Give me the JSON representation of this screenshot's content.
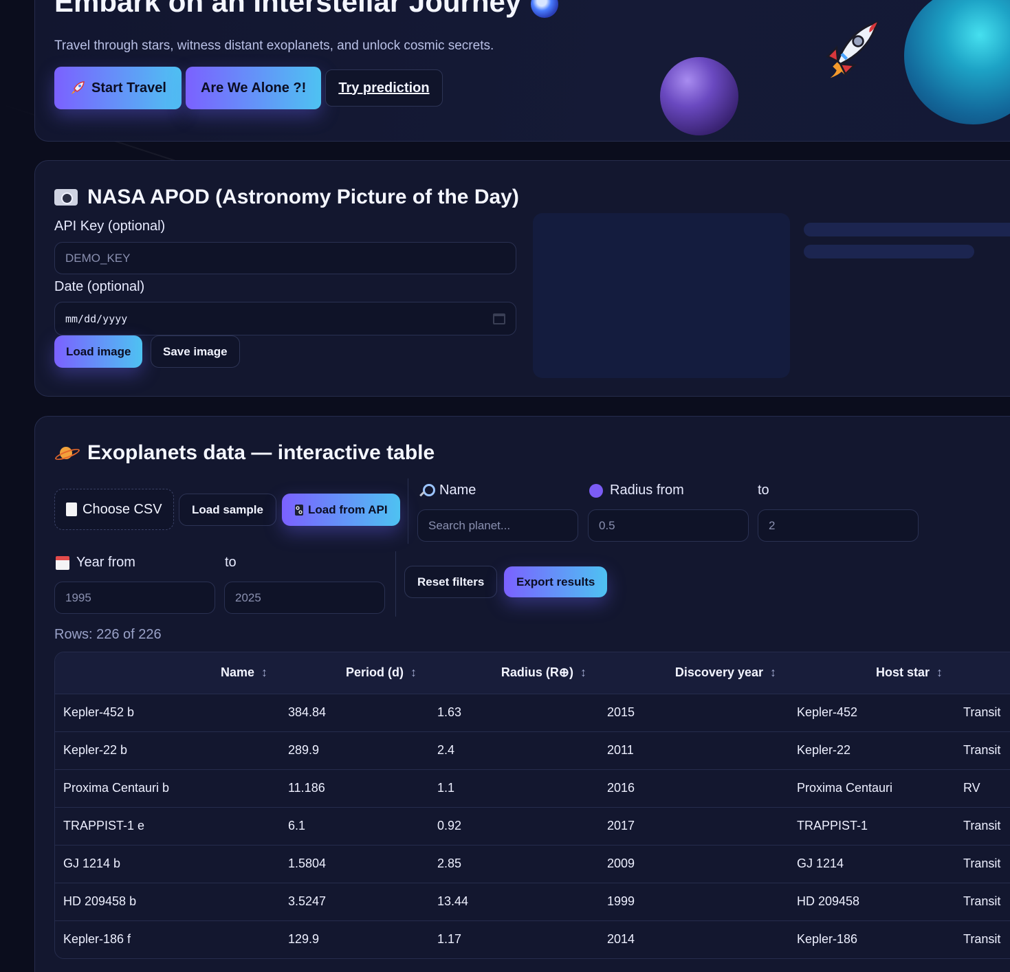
{
  "hero": {
    "title": "Embark on an Interstellar Journey",
    "subtitle": "Travel through stars, witness distant exoplanets, and unlock cosmic secrets.",
    "start_label": "Start Travel",
    "alone_label": "Are We Alone ?!",
    "prediction_label": "Try prediction"
  },
  "apod": {
    "title": "NASA APOD (Astronomy Picture of the Day)",
    "api_key_label": "API Key (optional)",
    "api_key_placeholder": "DEMO_KEY",
    "date_label": "Date (optional)",
    "date_placeholder": "mm/dd/yyyy",
    "load_label": "Load image",
    "save_label": "Save image"
  },
  "exo": {
    "title": "Exoplanets data — interactive table",
    "choose_csv_label": "Choose CSV",
    "load_sample_label": "Load sample",
    "load_api_label": "Load from API",
    "name_label": "Name",
    "name_placeholder": "Search planet...",
    "radius_from_label": "Radius from",
    "radius_to_label": "to",
    "radius_from_value": "0.5",
    "radius_to_value": "2",
    "year_from_label": "Year from",
    "year_to_label": "to",
    "year_from_value": "1995",
    "year_to_value": "2025",
    "reset_label": "Reset filters",
    "export_label": "Export results",
    "rows_info": "Rows: 226 of 226",
    "columns": [
      "Name",
      "Period (d)",
      "Radius (R⊕)",
      "Discovery year",
      "Host star",
      ""
    ],
    "sort_glyph": "↕",
    "rows": [
      [
        "Kepler-452 b",
        "384.84",
        "1.63",
        "2015",
        "Kepler-452",
        "Transit"
      ],
      [
        "Kepler-22 b",
        "289.9",
        "2.4",
        "2011",
        "Kepler-22",
        "Transit"
      ],
      [
        "Proxima Centauri b",
        "11.186",
        "1.1",
        "2016",
        "Proxima Centauri",
        "RV"
      ],
      [
        "TRAPPIST-1 e",
        "6.1",
        "0.92",
        "2017",
        "TRAPPIST-1",
        "Transit"
      ],
      [
        "GJ 1214 b",
        "1.5804",
        "2.85",
        "2009",
        "GJ 1214",
        "Transit"
      ],
      [
        "HD 209458 b",
        "3.5247",
        "13.44",
        "1999",
        "HD 209458",
        "Transit"
      ],
      [
        "Kepler-186 f",
        "129.9",
        "1.17",
        "2014",
        "Kepler-186",
        "Transit"
      ]
    ]
  },
  "icons": {
    "rocket": "rocket-icon",
    "galaxy": "galaxy-icon",
    "camera": "camera-icon",
    "saturn": "ringed-planet-icon",
    "document": "document-icon",
    "link": "link-icon",
    "search": "magnifier-icon",
    "radius": "purple-circle-icon",
    "calendar": "calendar-icon"
  },
  "colors": {
    "background": "#0b0d1d",
    "card": "#13172f",
    "accent_start": "#7b61ff",
    "accent_end": "#4ec2f2"
  }
}
